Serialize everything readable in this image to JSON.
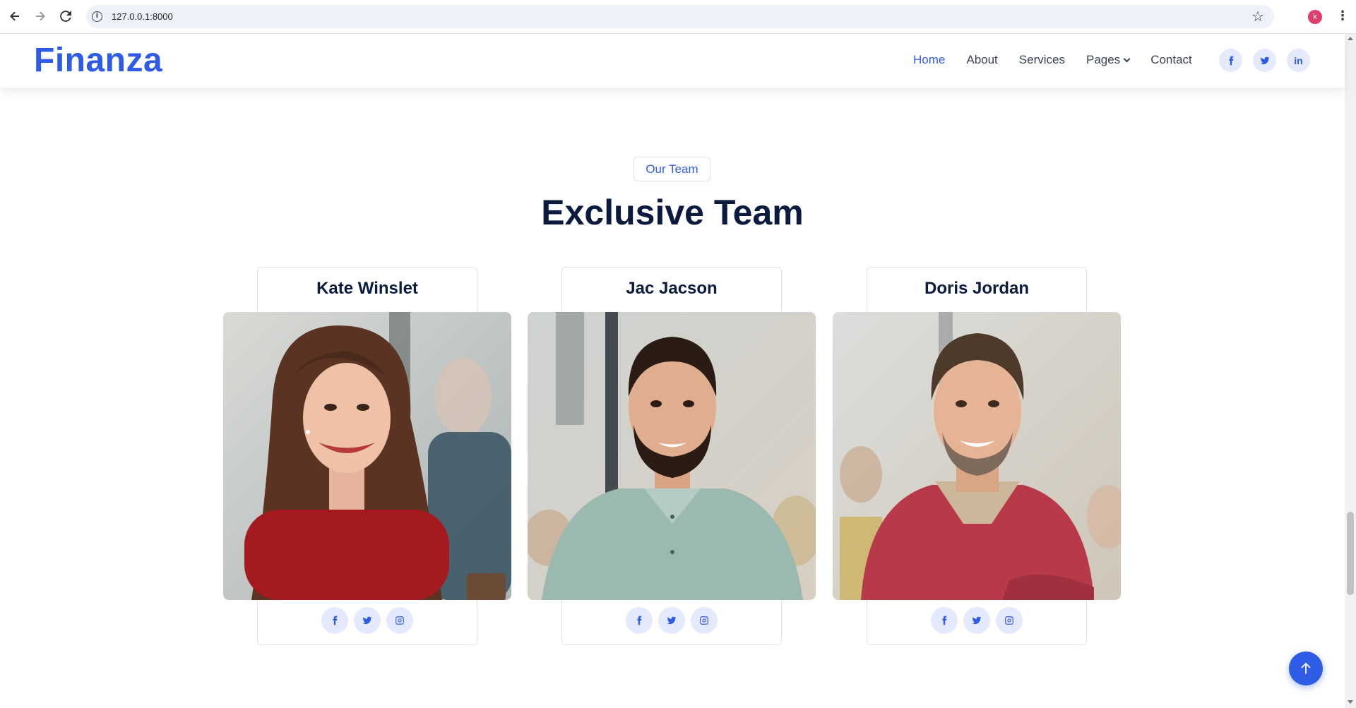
{
  "browser": {
    "url": "127.0.0.1:8000",
    "profile_initial": "k"
  },
  "header": {
    "logo": "Finanza",
    "nav": [
      {
        "label": "Home",
        "active": true
      },
      {
        "label": "About"
      },
      {
        "label": "Services"
      },
      {
        "label": "Pages",
        "dropdown": true
      },
      {
        "label": "Contact"
      }
    ],
    "social": [
      "facebook-icon",
      "twitter-icon",
      "linkedin-icon"
    ],
    "linkedin_text": "in"
  },
  "team": {
    "eyebrow": "Our Team",
    "title": "Exclusive Team",
    "members": [
      {
        "name": "Kate Winslet",
        "social": [
          "facebook-icon",
          "twitter-icon",
          "instagram-icon"
        ]
      },
      {
        "name": "Jac Jacson",
        "social": [
          "facebook-icon",
          "twitter-icon",
          "instagram-icon"
        ]
      },
      {
        "name": "Doris Jordan",
        "social": [
          "facebook-icon",
          "twitter-icon",
          "instagram-icon"
        ]
      }
    ]
  },
  "colors": {
    "brand": "#2f5ce6",
    "heading": "#0b1b3f",
    "text": "#3a4253"
  }
}
